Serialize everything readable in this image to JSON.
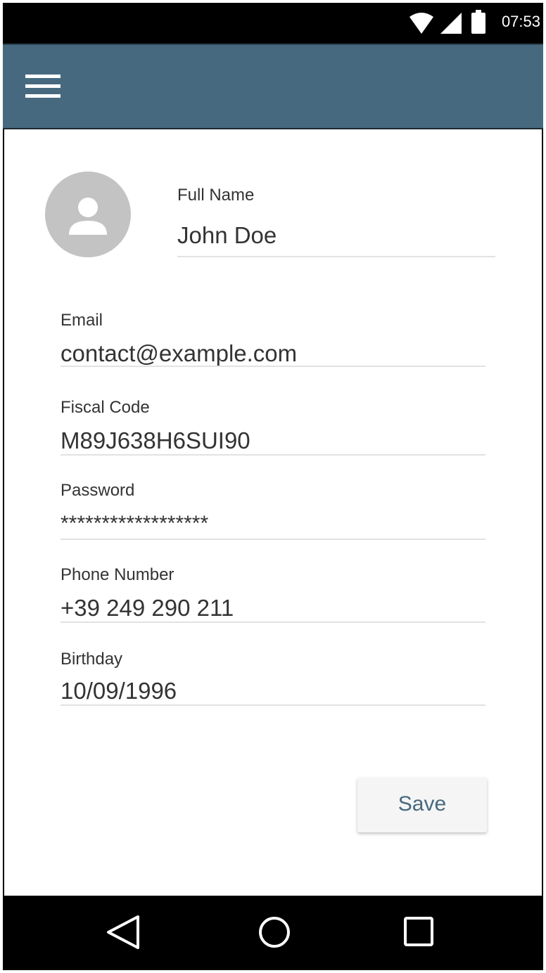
{
  "status_bar": {
    "time": "07:53",
    "icons": [
      "wifi-icon",
      "signal-icon",
      "battery-icon"
    ]
  },
  "app_bar": {
    "menu_icon": "hamburger-menu-icon",
    "color": "#46697f"
  },
  "profile": {
    "avatar_icon": "person-icon",
    "full_name_label": "Full Name",
    "full_name_value": "John Doe"
  },
  "fields": {
    "email": {
      "label": "Email",
      "value": "contact@example.com"
    },
    "fiscal_code": {
      "label": "Fiscal Code",
      "value": "M89J638H6SUI90"
    },
    "password": {
      "label": "Password",
      "value": "******************"
    },
    "phone": {
      "label": "Phone Number",
      "value": "+39 249 290 211"
    },
    "birthday": {
      "label": "Birthday",
      "value": "10/09/1996"
    }
  },
  "actions": {
    "save_label": "Save",
    "accent_color": "#46697f"
  },
  "nav_bar": {
    "icons": [
      "back-icon",
      "home-icon",
      "recents-icon"
    ]
  }
}
